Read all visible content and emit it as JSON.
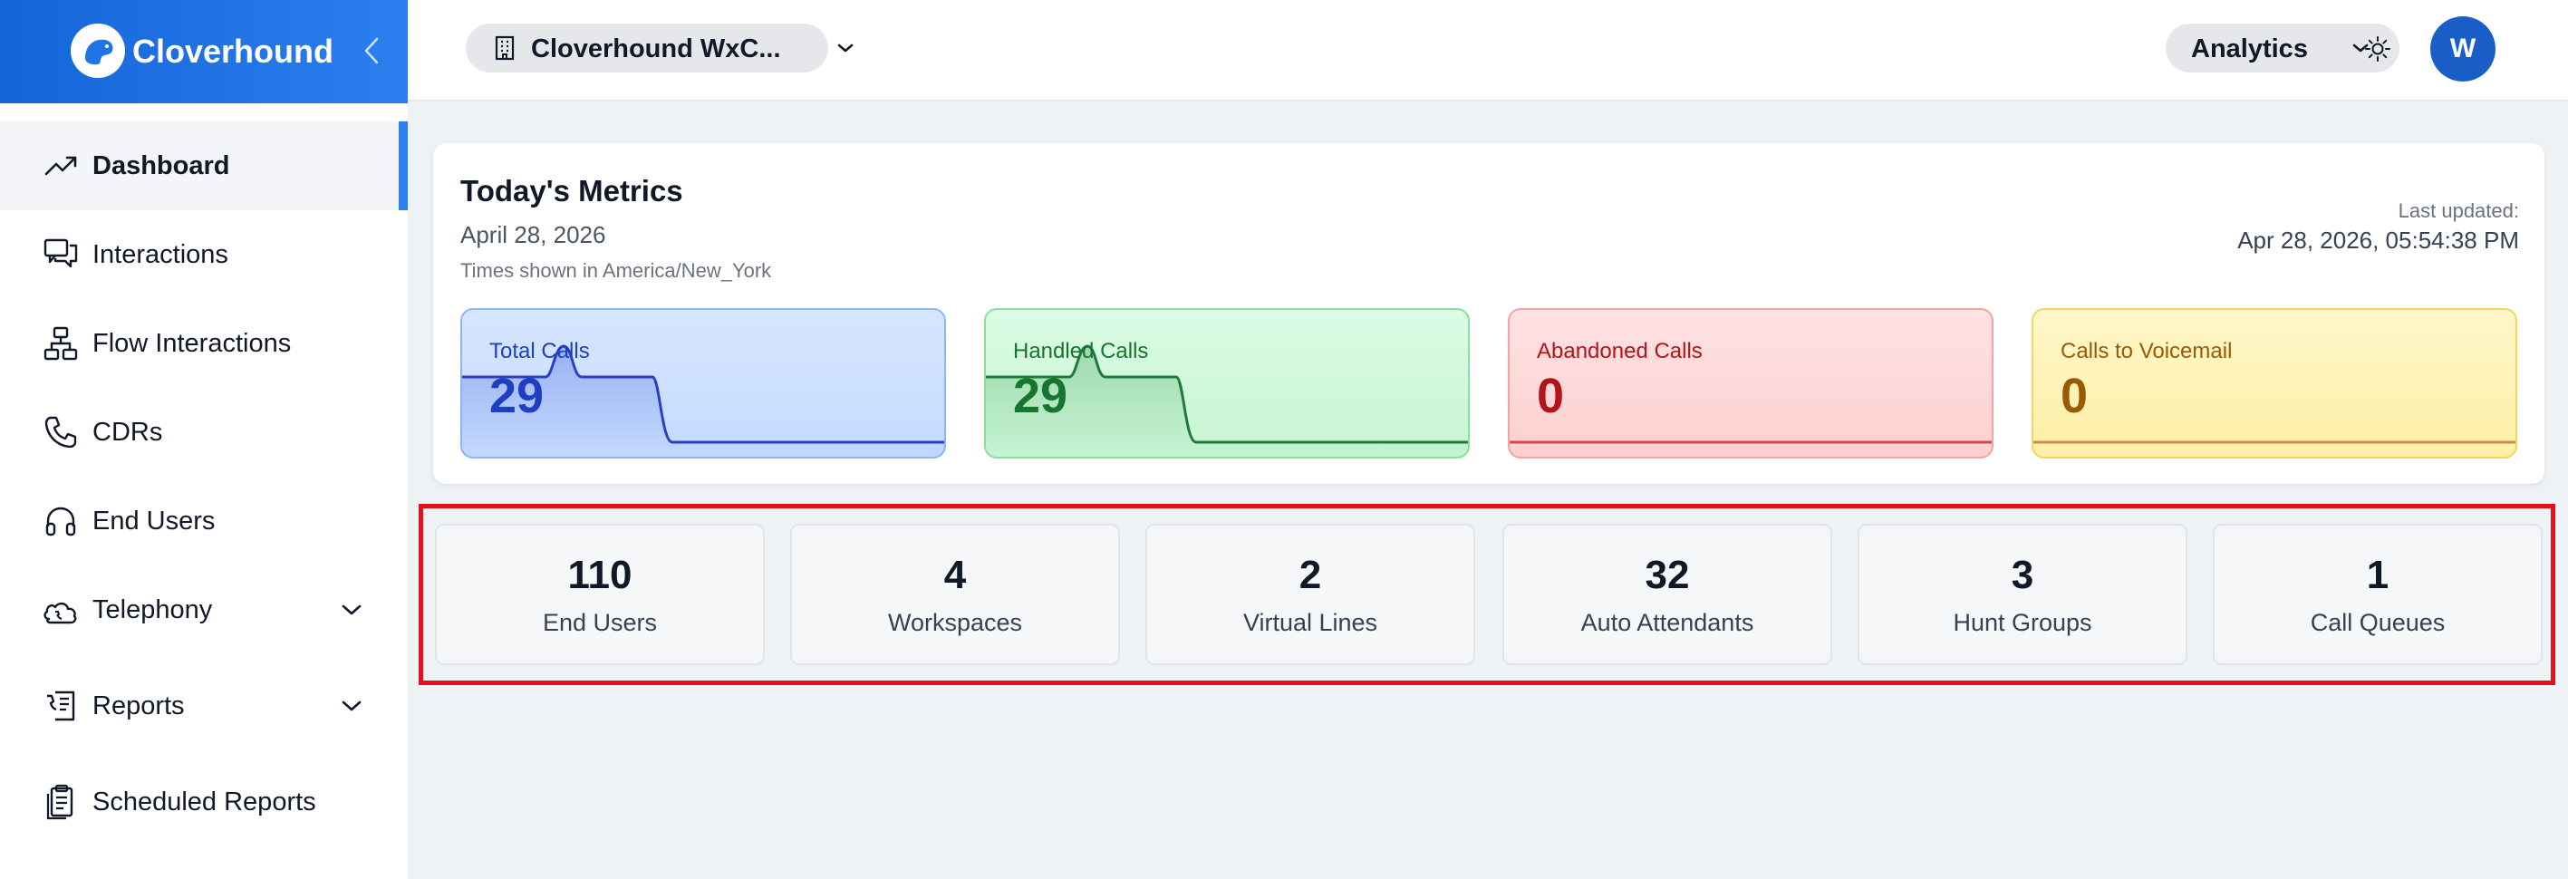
{
  "brand": {
    "name": "Cloverhound"
  },
  "sidebar": {
    "items": [
      {
        "label": "Dashboard",
        "icon": "trending-up-icon",
        "active": true
      },
      {
        "label": "Interactions",
        "icon": "chat-bubbles-icon"
      },
      {
        "label": "Flow Interactions",
        "icon": "flow-diagram-icon"
      },
      {
        "label": "CDRs",
        "icon": "phone-icon"
      },
      {
        "label": "End Users",
        "icon": "headset-icon"
      },
      {
        "label": "Telephony",
        "icon": "phone-cloud-icon",
        "expandable": true
      },
      {
        "label": "Reports",
        "icon": "phone-document-icon",
        "expandable": true
      },
      {
        "label": "Scheduled Reports",
        "icon": "clipboard-icon"
      }
    ]
  },
  "topbar": {
    "org_label": "Cloverhound WxC...",
    "analytics_label": "Analytics",
    "avatar_initial": "W"
  },
  "metrics": {
    "title": "Today's Metrics",
    "date": "April 28, 2026",
    "timezone_note": "Times shown in America/New_York",
    "last_updated_label": "Last updated:",
    "last_updated_value": "Apr 28, 2026, 05:54:38 PM",
    "tiles": [
      {
        "label": "Total Calls",
        "value": "29",
        "color": "#1e3fbf"
      },
      {
        "label": "Handled Calls",
        "value": "29",
        "color": "#16752f"
      },
      {
        "label": "Abandoned Calls",
        "value": "0",
        "color": "#b3131b"
      },
      {
        "label": "Calls to Voicemail",
        "value": "0",
        "color": "#9a5a05"
      }
    ]
  },
  "stats": [
    {
      "value": "110",
      "label": "End Users"
    },
    {
      "value": "4",
      "label": "Workspaces"
    },
    {
      "value": "2",
      "label": "Virtual Lines"
    },
    {
      "value": "32",
      "label": "Auto Attendants"
    },
    {
      "value": "3",
      "label": "Hunt Groups"
    },
    {
      "value": "1",
      "label": "Call Queues"
    }
  ],
  "colors": {
    "brand": "#1f74e6",
    "highlight": "#e3111b"
  }
}
